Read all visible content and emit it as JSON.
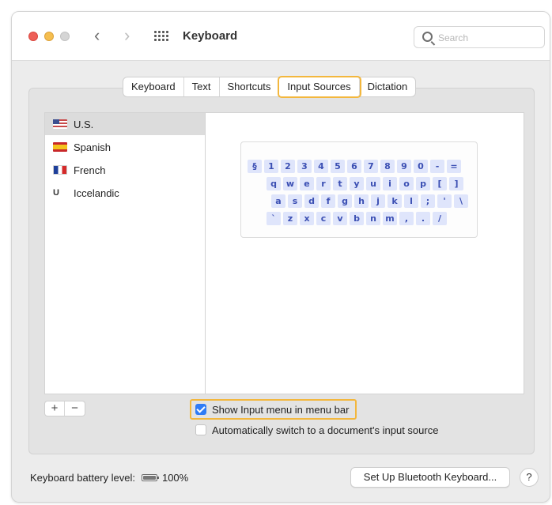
{
  "window": {
    "title": "Keyboard"
  },
  "search": {
    "placeholder": "Search"
  },
  "tabs": [
    {
      "label": "Keyboard"
    },
    {
      "label": "Text"
    },
    {
      "label": "Shortcuts"
    },
    {
      "label": "Input Sources",
      "active": true
    },
    {
      "label": "Dictation"
    }
  ],
  "input_sources": [
    {
      "label": "U.S.",
      "flag_icon": "us-flag-icon",
      "selected": true
    },
    {
      "label": "Spanish",
      "flag_icon": "spain-flag-icon"
    },
    {
      "label": "French",
      "flag_icon": "france-flag-icon"
    },
    {
      "label": "Iccelandic",
      "flag_icon": "u-glyph-icon",
      "glyph": "U"
    }
  ],
  "keyboard_preview": {
    "rows": [
      [
        "§",
        "1",
        "2",
        "3",
        "4",
        "5",
        "6",
        "7",
        "8",
        "9",
        "0",
        "-",
        "="
      ],
      [
        "q",
        "w",
        "e",
        "r",
        "t",
        "y",
        "u",
        "i",
        "o",
        "p",
        "[",
        "]"
      ],
      [
        "a",
        "s",
        "d",
        "f",
        "g",
        "h",
        "j",
        "k",
        "l",
        ";",
        "'",
        "\\"
      ],
      [
        "`",
        "z",
        "x",
        "c",
        "v",
        "b",
        "n",
        "m",
        ",",
        ".",
        "/"
      ]
    ]
  },
  "list_controls": {
    "add_label": "+",
    "remove_label": "−"
  },
  "options": {
    "show_input_menu": {
      "label": "Show Input menu in menu bar",
      "checked": true
    },
    "auto_switch": {
      "label": "Automatically switch to a document's input source",
      "checked": false
    }
  },
  "footer": {
    "battery_label": "Keyboard battery level:",
    "battery_value": "100%",
    "bluetooth_button": "Set Up Bluetooth Keyboard...",
    "help_label": "?"
  },
  "colors": {
    "accent": "#2f7cf6",
    "highlight": "#f3b73d",
    "key_bg": "#dfe5fb",
    "key_text": "#3b4fb3"
  }
}
